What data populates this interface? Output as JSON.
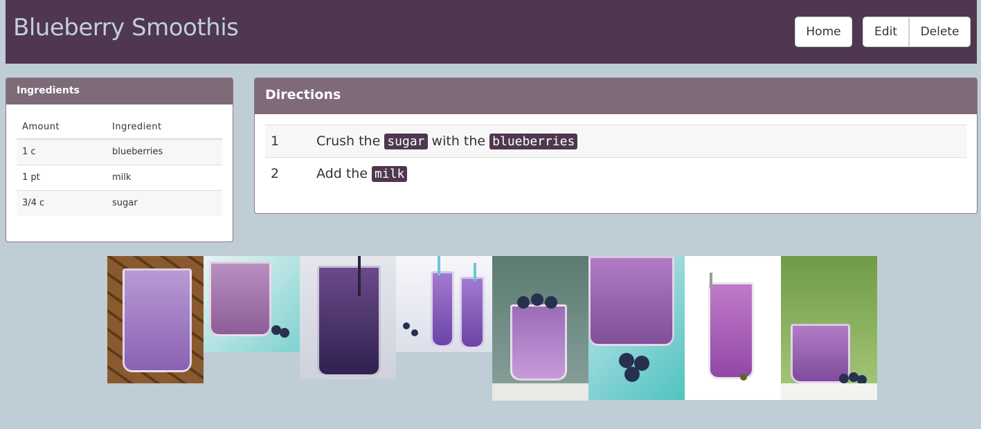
{
  "navbar": {
    "brand": "Blueberry Smoothis",
    "home_label": "Home",
    "edit_label": "Edit",
    "delete_label": "Delete"
  },
  "ingredients": {
    "title": "Ingredients",
    "headers": {
      "amount": "Amount",
      "ingredient": "Ingredient"
    },
    "rows": [
      {
        "amount": "1 c",
        "ingredient": "blueberries"
      },
      {
        "amount": "1 pt",
        "ingredient": "milk"
      },
      {
        "amount": "3/4 c",
        "ingredient": "sugar"
      }
    ]
  },
  "directions": {
    "title": "Directions",
    "steps": [
      {
        "num": "1",
        "t1": "Crush the ",
        "c1": "sugar",
        "t2": " with the ",
        "c2": "blueberries"
      },
      {
        "num": "2",
        "t1": "Add the ",
        "c1": "milk"
      }
    ]
  },
  "colors": {
    "navbar": "#4e374f",
    "page_bg": "#bfcdd6",
    "panel_heading": "#7f6a79",
    "ingredient_tag": "#4e374f"
  }
}
